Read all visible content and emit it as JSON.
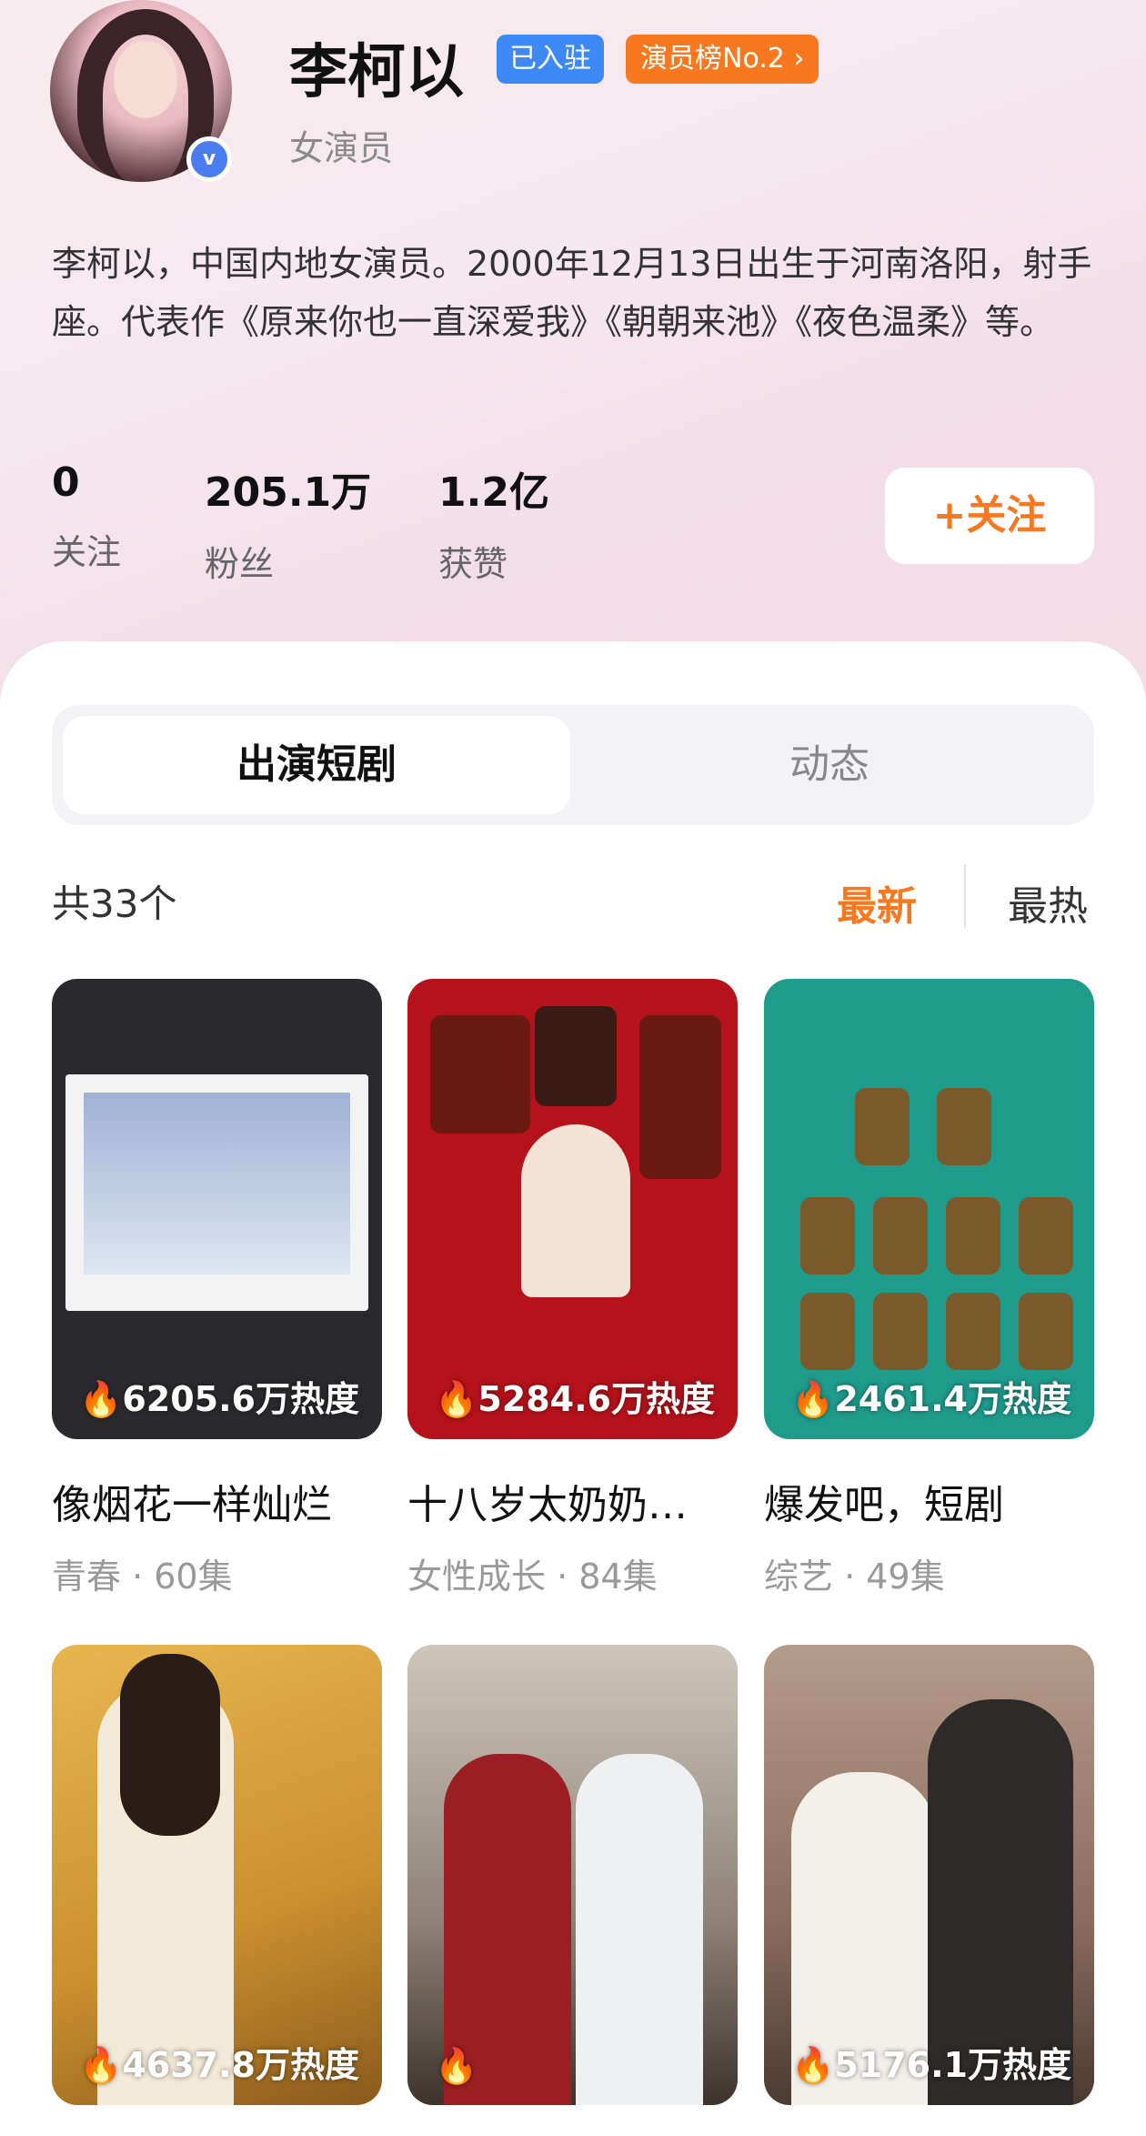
{
  "profile": {
    "name": "李柯以",
    "badge_joined": "已入驻",
    "badge_rank": "演员榜No.2 ›",
    "role": "女演员",
    "verified_icon": "v",
    "bio": "李柯以，中国内地女演员。2000年12月13日出生于河南洛阳，射手座。代表作《原来你也一直深爱我》《朝朝来池》《夜色温柔》等。"
  },
  "stats": [
    {
      "value": "0",
      "label": "关注"
    },
    {
      "value": "205.1万",
      "label": "粉丝"
    },
    {
      "value": "1.2亿",
      "label": "获赞"
    }
  ],
  "follow_button": "+关注",
  "tabs": {
    "active": "出演短剧",
    "inactive": "动态"
  },
  "list_header": {
    "count": "共33个",
    "sort_new": "最新",
    "sort_hot": "最热"
  },
  "dramas": [
    {
      "title": "像烟花一样灿烂",
      "meta": "青春 · 60集",
      "heat": "🔥6205.6万热度",
      "color": "#2a2a2e"
    },
    {
      "title": "十八岁太奶奶…",
      "meta": "女性成长 · 84集",
      "heat": "🔥5284.6万热度",
      "color": "#b5121b"
    },
    {
      "title": "爆发吧，短剧",
      "meta": "综艺 · 49集",
      "heat": "🔥2461.4万热度",
      "color": "#1f9b8c"
    },
    {
      "title": "",
      "meta": "",
      "heat": "🔥4637.8万热度",
      "color": "#c9902f"
    },
    {
      "title": "",
      "meta": "",
      "heat": "🔥",
      "color": "#6b5e55"
    },
    {
      "title": "",
      "meta": "",
      "heat": "🔥5176.1万热度",
      "color": "#8a6c5c"
    }
  ]
}
